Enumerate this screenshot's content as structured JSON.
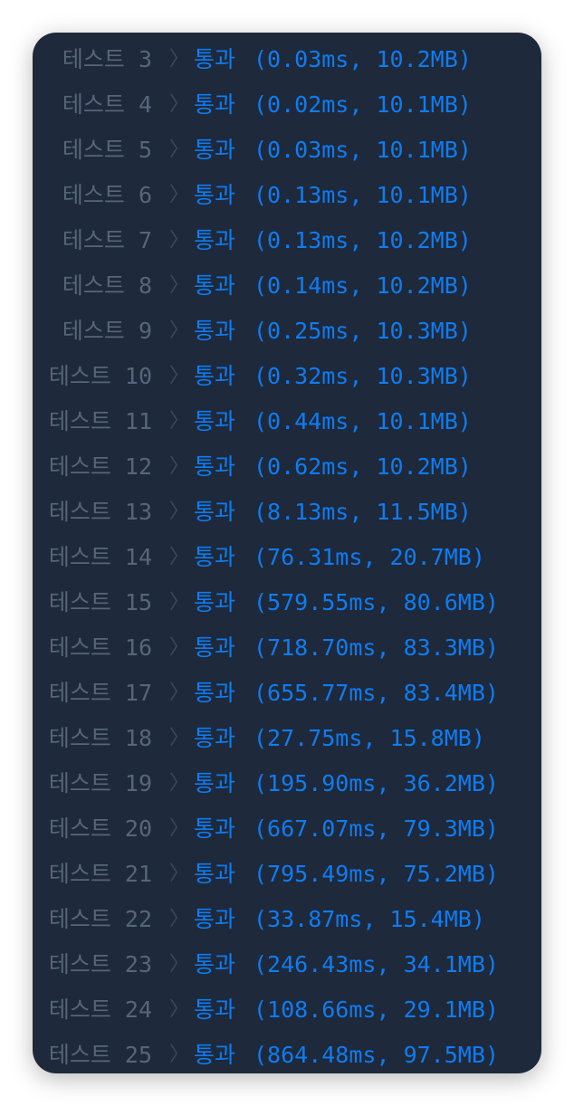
{
  "tests": [
    {
      "label": "테스트 3",
      "status": "통과",
      "result": "(0.03ms, 10.2MB)"
    },
    {
      "label": "테스트 4",
      "status": "통과",
      "result": "(0.02ms, 10.1MB)"
    },
    {
      "label": "테스트 5",
      "status": "통과",
      "result": "(0.03ms, 10.1MB)"
    },
    {
      "label": "테스트 6",
      "status": "통과",
      "result": "(0.13ms, 10.1MB)"
    },
    {
      "label": "테스트 7",
      "status": "통과",
      "result": "(0.13ms, 10.2MB)"
    },
    {
      "label": "테스트 8",
      "status": "통과",
      "result": "(0.14ms, 10.2MB)"
    },
    {
      "label": "테스트 9",
      "status": "통과",
      "result": "(0.25ms, 10.3MB)"
    },
    {
      "label": "테스트 10",
      "status": "통과",
      "result": "(0.32ms, 10.3MB)"
    },
    {
      "label": "테스트 11",
      "status": "통과",
      "result": "(0.44ms, 10.1MB)"
    },
    {
      "label": "테스트 12",
      "status": "통과",
      "result": "(0.62ms, 10.2MB)"
    },
    {
      "label": "테스트 13",
      "status": "통과",
      "result": "(8.13ms, 11.5MB)"
    },
    {
      "label": "테스트 14",
      "status": "통과",
      "result": "(76.31ms, 20.7MB)"
    },
    {
      "label": "테스트 15",
      "status": "통과",
      "result": "(579.55ms, 80.6MB)"
    },
    {
      "label": "테스트 16",
      "status": "통과",
      "result": "(718.70ms, 83.3MB)"
    },
    {
      "label": "테스트 17",
      "status": "통과",
      "result": "(655.77ms, 83.4MB)"
    },
    {
      "label": "테스트 18",
      "status": "통과",
      "result": "(27.75ms, 15.8MB)"
    },
    {
      "label": "테스트 19",
      "status": "통과",
      "result": "(195.90ms, 36.2MB)"
    },
    {
      "label": "테스트 20",
      "status": "통과",
      "result": "(667.07ms, 79.3MB)"
    },
    {
      "label": "테스트 21",
      "status": "통과",
      "result": "(795.49ms, 75.2MB)"
    },
    {
      "label": "테스트 22",
      "status": "통과",
      "result": "(33.87ms, 15.4MB)"
    },
    {
      "label": "테스트 23",
      "status": "통과",
      "result": "(246.43ms, 34.1MB)"
    },
    {
      "label": "테스트 24",
      "status": "통과",
      "result": "(108.66ms, 29.1MB)"
    },
    {
      "label": "테스트 25",
      "status": "통과",
      "result": "(864.48ms, 97.5MB)"
    }
  ],
  "separator_icon": "chevron-right-icon",
  "colors": {
    "panel_background": "#1e293b",
    "label": "#56667a",
    "separator": "#3b4a5e",
    "pass": "#0f7cf0"
  }
}
